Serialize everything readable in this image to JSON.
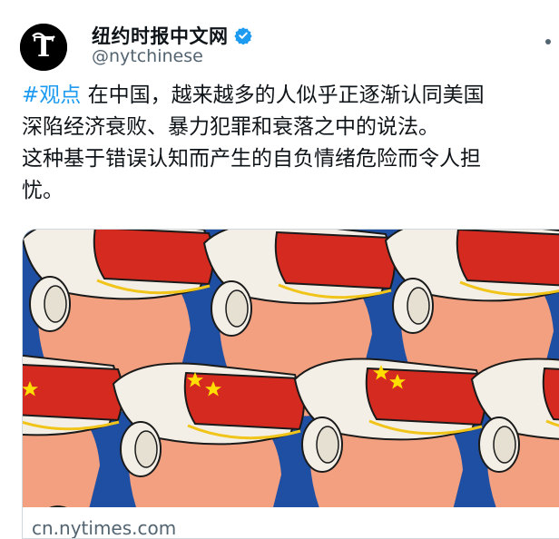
{
  "account": {
    "display_name": "纽约时报中文网",
    "handle": "@nytchinese",
    "avatar_icon": "nyt-logo-icon",
    "verified_icon": "verified-badge-icon",
    "verified_color": "#1d9bf0"
  },
  "tweet": {
    "hashtag": "#观点",
    "line1_rest": " 在中国，越来越多的人似乎正逐渐认同美国",
    "line2": "深陷经济衰败、暴力犯罪和衰落之中的说法。",
    "line3": "这种基于错误认知而产生的自负情绪危险而令人担",
    "line4": "忧。"
  },
  "card": {
    "image_description_icon": "vr-headset-illustration",
    "domain": "cn.nytimes.com"
  },
  "colors": {
    "background": "#ffffff",
    "text": "#0f1419",
    "secondary": "#536471",
    "link": "#1d9bf0",
    "illustration_bg": "#1f4fa3",
    "headset_red": "#d42a1f",
    "headset_white": "#f3efe6",
    "skin": "#f2a07f"
  }
}
